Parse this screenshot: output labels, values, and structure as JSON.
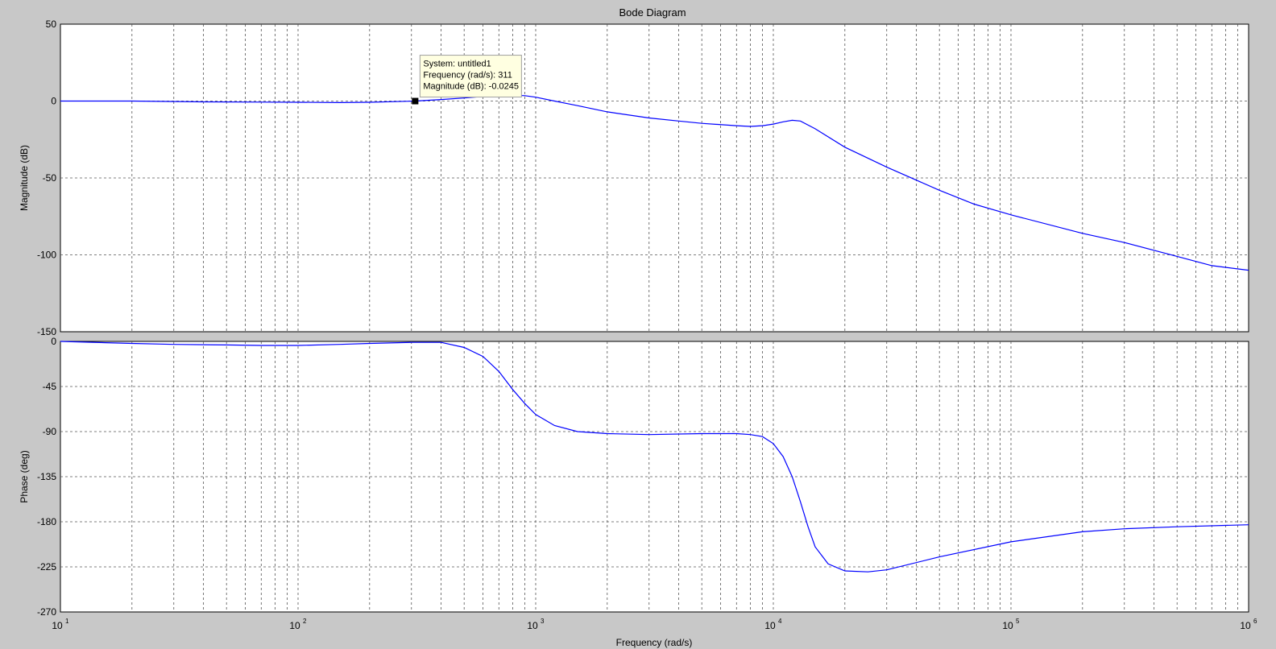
{
  "chart_data": {
    "type": "line",
    "title": "Bode Diagram",
    "xlabel": "Frequency  (rad/s)",
    "x_scale": "log",
    "xlim": [
      10,
      1000000
    ],
    "x_tick_labels": [
      {
        "base": "10",
        "exp": "1"
      },
      {
        "base": "10",
        "exp": "2"
      },
      {
        "base": "10",
        "exp": "3"
      },
      {
        "base": "10",
        "exp": "4"
      },
      {
        "base": "10",
        "exp": "5"
      },
      {
        "base": "10",
        "exp": "6"
      }
    ],
    "grid": true,
    "line_color": "#0000ff",
    "panels": [
      {
        "name": "magnitude",
        "ylabel": "Magnitude (dB)",
        "ylim": [
          -150,
          50
        ],
        "yticks": [
          50,
          0,
          -50,
          -100,
          -150
        ],
        "series": [
          {
            "x": [
              10,
              20,
              40,
              70,
              100,
              150,
              200,
              311,
              400,
              500,
              600,
              700,
              800,
              900,
              1000,
              1200,
              1500,
              2000,
              3000,
              4000,
              5000,
              7000,
              8000,
              9000,
              10000,
              11000,
              12000,
              13000,
              15000,
              20000,
              30000,
              50000,
              70000,
              100000,
              200000,
              300000,
              500000,
              700000,
              1000000
            ],
            "y": [
              0,
              0,
              -0.5,
              -0.7,
              -0.8,
              -1,
              -0.8,
              -0.0245,
              1,
              2,
              3,
              3.5,
              3.8,
              3.5,
              2.5,
              0,
              -3,
              -7,
              -11,
              -13,
              -14.5,
              -16,
              -16.5,
              -16,
              -15,
              -13.5,
              -12.5,
              -13,
              -18,
              -30,
              -43,
              -58,
              -67,
              -74,
              -86,
              -92,
              -101,
              -107,
              -110
            ]
          }
        ]
      },
      {
        "name": "phase",
        "ylabel": "Phase (deg)",
        "ylim": [
          -270,
          0
        ],
        "yticks": [
          0,
          -45,
          -90,
          -135,
          -180,
          -225,
          -270
        ],
        "series": [
          {
            "x": [
              10,
              20,
              30,
              50,
              70,
              100,
              150,
              200,
              300,
              400,
              500,
              600,
              700,
              800,
              900,
              1000,
              1200,
              1500,
              2000,
              3000,
              5000,
              7000,
              8000,
              9000,
              10000,
              11000,
              12000,
              13000,
              14000,
              15000,
              17000,
              20000,
              25000,
              30000,
              50000,
              100000,
              200000,
              300000,
              500000,
              1000000
            ],
            "y": [
              0,
              -2,
              -3,
              -3.5,
              -4,
              -4,
              -3,
              -2,
              -1,
              -1,
              -6,
              -15,
              -30,
              -48,
              -62,
              -73,
              -84,
              -90,
              -92,
              -93,
              -92,
              -92,
              -93,
              -95,
              -102,
              -115,
              -135,
              -160,
              -185,
              -205,
              -222,
              -229,
              -230,
              -228,
              -215,
              -200,
              -190,
              -187,
              -185,
              -183
            ]
          }
        ]
      }
    ],
    "datatip": {
      "x": 311,
      "y": -0.0245,
      "lines": [
        "System: untitled1",
        "Frequency (rad/s): 311",
        "Magnitude (dB): -0.0245"
      ]
    }
  }
}
